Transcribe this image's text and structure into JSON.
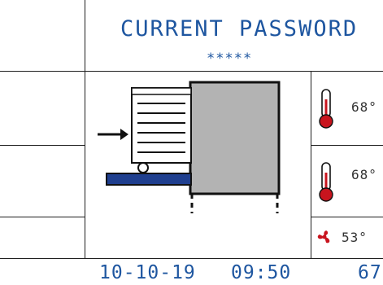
{
  "header": {
    "title": "CURRENT PASSWORD",
    "password_mask": "*****"
  },
  "sensors": [
    {
      "icon": "thermometer-icon",
      "value": "68°"
    },
    {
      "icon": "thermometer-icon",
      "value": "68°"
    },
    {
      "icon": "fan-icon",
      "value": "53°"
    }
  ],
  "footer": {
    "date": "10-10-19",
    "time": "09:50",
    "value": "67"
  },
  "colors": {
    "lcd_text": "#1e56a0",
    "thermometer": "#c8141e",
    "fan": "#c8141e",
    "conveyor_belt": "#1f3f8f",
    "chamber": "#b3b3b3"
  }
}
